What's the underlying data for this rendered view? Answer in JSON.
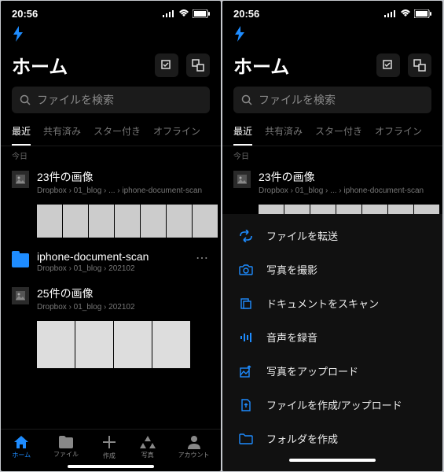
{
  "status": {
    "time": "20:56"
  },
  "header": {
    "title": "ホーム"
  },
  "search": {
    "placeholder": "ファイルを検索"
  },
  "tabs": [
    "最近",
    "共有済み",
    "スター付き",
    "オフライン"
  ],
  "section_today": "今日",
  "items": [
    {
      "title": "23件の画像",
      "path": "Dropbox › 01_blog › ... › iphone-document-scan"
    },
    {
      "title": "iphone-document-scan",
      "path": "Dropbox › 01_blog › 202102"
    },
    {
      "title": "25件の画像",
      "path": "Dropbox › 01_blog › 202102"
    }
  ],
  "tabbar": {
    "home": "ホーム",
    "files": "ファイル",
    "create": "作成",
    "photos": "写真",
    "account": "アカウント"
  },
  "sheet": [
    "ファイルを転送",
    "写真を撮影",
    "ドキュメントをスキャン",
    "音声を録音",
    "写真をアップロード",
    "ファイルを作成/アップロード",
    "フォルダを作成"
  ]
}
